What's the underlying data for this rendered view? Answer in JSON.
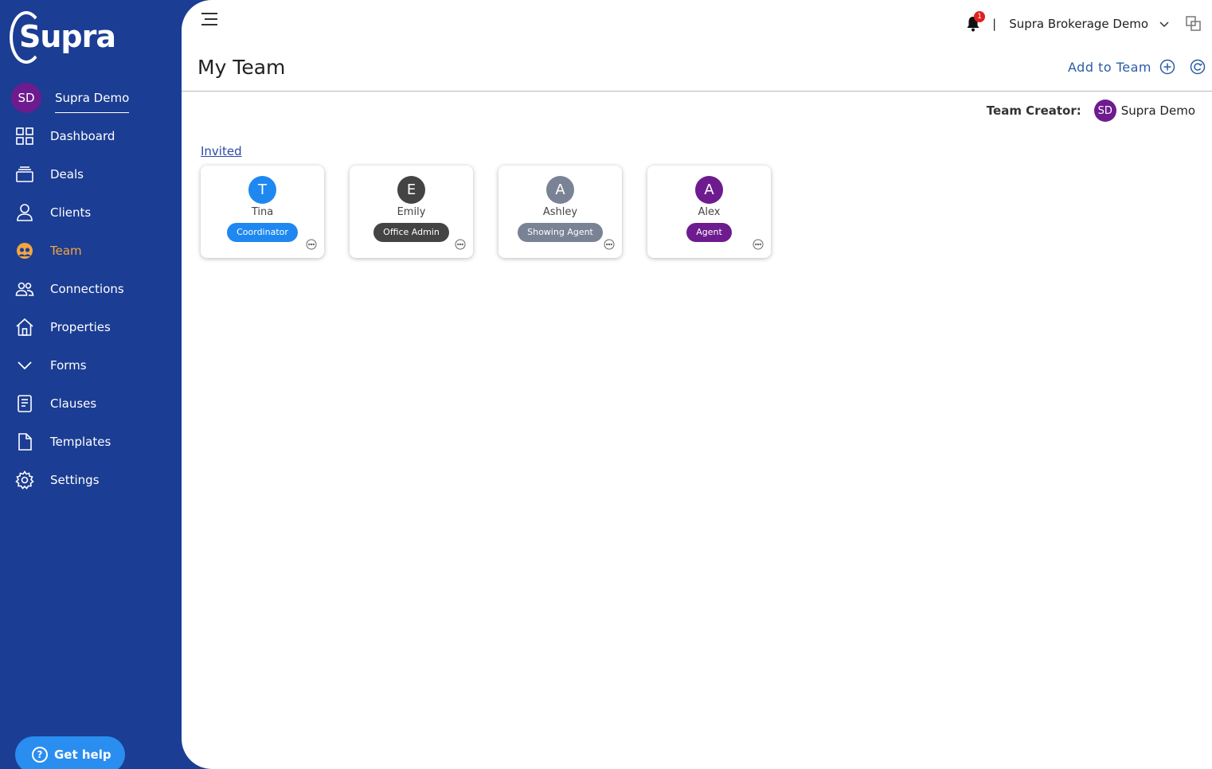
{
  "brand": {
    "logo_text": "Supra"
  },
  "user": {
    "initials": "SD",
    "name": "Supra Demo"
  },
  "sidebar": {
    "items": [
      {
        "label": "Dashboard",
        "icon": "dashboard-icon"
      },
      {
        "label": "Deals",
        "icon": "deals-icon"
      },
      {
        "label": "Clients",
        "icon": "person-icon"
      },
      {
        "label": "Team",
        "icon": "team-icon",
        "active": true
      },
      {
        "label": "Connections",
        "icon": "connections-icon"
      },
      {
        "label": "Properties",
        "icon": "home-icon"
      },
      {
        "label": "Forms",
        "icon": "chevron-down-icon"
      },
      {
        "label": "Clauses",
        "icon": "document-icon"
      },
      {
        "label": "Templates",
        "icon": "file-icon"
      },
      {
        "label": "Settings",
        "icon": "gear-icon"
      }
    ],
    "help_label": "Get help",
    "help_glyph": "?"
  },
  "topbar": {
    "notification_count": "1",
    "separator": "|",
    "brokerage": "Supra Brokerage Demo"
  },
  "page": {
    "title": "My Team",
    "add_to_team": "Add to Team",
    "creator_label": "Team Creator:",
    "creator_initials": "SD",
    "creator_name": "Supra Demo",
    "section_label": "Invited"
  },
  "members": [
    {
      "initial": "T",
      "name": "Tina",
      "role": "Coordinator",
      "avatar_color": "#1e88f0",
      "role_color": "#1e88f0"
    },
    {
      "initial": "E",
      "name": "Emily",
      "role": "Office Admin",
      "avatar_color": "#444444",
      "role_color": "#444444"
    },
    {
      "initial": "A",
      "name": "Ashley",
      "role": "Showing Agent",
      "avatar_color": "#7a8296",
      "role_color": "#7a8296"
    },
    {
      "initial": "A",
      "name": "Alex",
      "role": "Agent",
      "avatar_color": "#6e1b8f",
      "role_color": "#6e1b8f"
    }
  ],
  "colors": {
    "sidebar": "#1b3d93",
    "active_nav": "#f2a541",
    "link": "#2b5aa8",
    "help_button": "#2a8df0"
  }
}
